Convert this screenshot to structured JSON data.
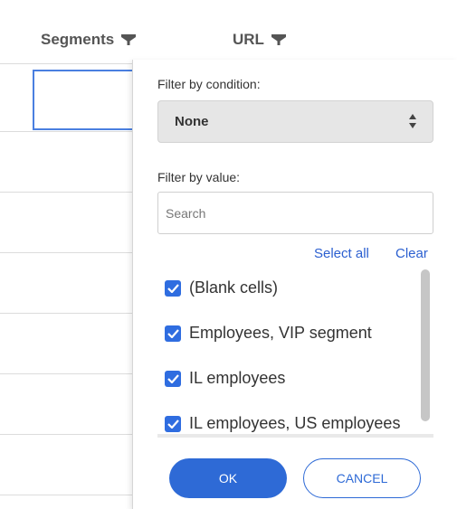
{
  "columns": [
    {
      "label": "Segments",
      "icon": "filter-icon"
    },
    {
      "label": "URL",
      "icon": "filter-icon"
    }
  ],
  "filter_panel": {
    "condition_label": "Filter by condition:",
    "condition_value": "None",
    "value_label": "Filter by value:",
    "search_placeholder": "Search",
    "select_all": "Select all",
    "clear": "Clear",
    "items": [
      {
        "label": "(Blank cells)",
        "checked": true
      },
      {
        "label": "Employees, VIP segment",
        "checked": true
      },
      {
        "label": "IL employees",
        "checked": true
      },
      {
        "label": "IL employees, US employees",
        "checked": true
      }
    ],
    "ok_label": "OK",
    "cancel_label": "CANCEL"
  },
  "colors": {
    "accent": "#2e6ad6",
    "checkbox": "#2f6de0",
    "selection_border": "#4a7fe0"
  }
}
